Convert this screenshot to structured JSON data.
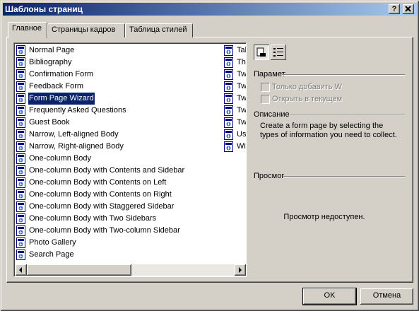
{
  "window": {
    "title": "Шаблоны страниц",
    "help_label": "?",
    "close_label": "X"
  },
  "tabs": [
    {
      "label": "Главное"
    },
    {
      "label": "Страницы кадров"
    },
    {
      "label": "Таблица стилей"
    }
  ],
  "list": {
    "col1": [
      "Normal Page",
      "Bibliography",
      "Confirmation Form",
      "Feedback Form",
      "Form Page Wizard",
      "Frequently Asked Questions",
      "Guest Book",
      "Narrow, Left-aligned Body",
      "Narrow, Right-aligned Body",
      "One-column Body",
      "One-column Body with Contents and Sidebar",
      "One-column Body with Contents on Left",
      "One-column Body with Contents on Right",
      "One-column Body with Staggered Sidebar",
      "One-column Body with Two Sidebars",
      "One-column Body with Two-column Sidebar",
      "Photo Gallery",
      "Search Page"
    ],
    "col2": [
      "Tal",
      "Thi",
      "Tw",
      "Tw",
      "Tw",
      "Tw",
      "Tw",
      "Us",
      "Wi"
    ],
    "selected": "Form Page Wizard"
  },
  "options": {
    "header": "Парамет",
    "add_label": "Только добавить W",
    "open_label": "Открыть в текущем"
  },
  "description": {
    "header": "Описание",
    "text": "Create a form page by selecting the types of information you need to collect."
  },
  "preview": {
    "header": "Просмог",
    "text": "Просмотр недоступен."
  },
  "buttons": {
    "ok": "OK",
    "cancel": "Отмена"
  },
  "colors": {
    "titlebar": "#0a246a",
    "selection": "#0a246a",
    "face": "#d4d0c8"
  }
}
